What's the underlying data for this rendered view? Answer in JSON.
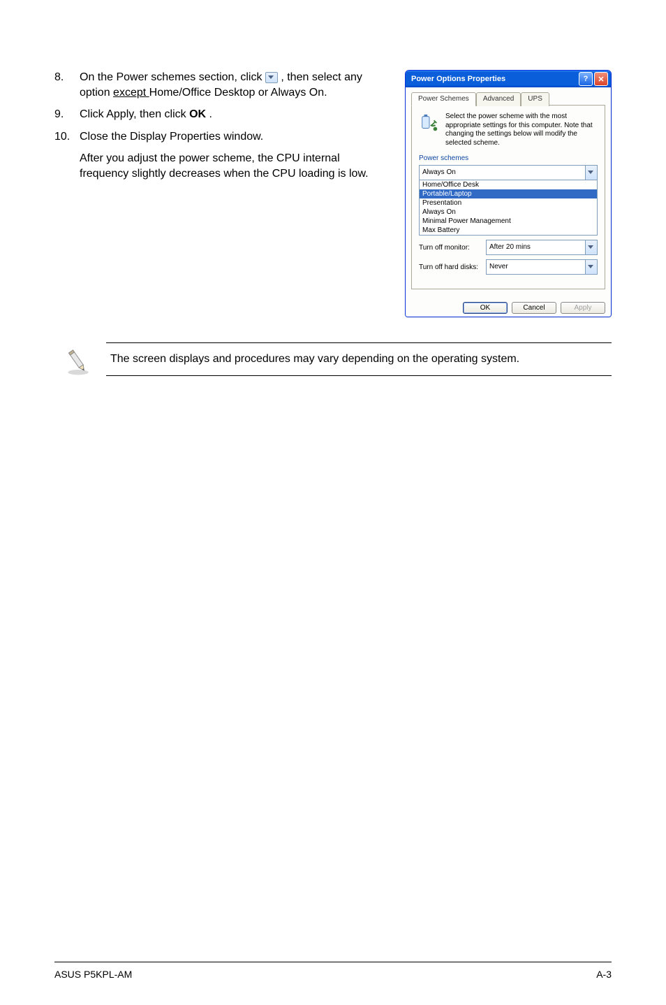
{
  "steps": [
    {
      "num": "8.",
      "pre": "On the Power schemes section, click ",
      "post": ", then select any option ",
      "underl": "except ",
      "after_underl": "Home/Office Desktop or Always On."
    },
    {
      "num": "9.",
      "text_pre": "Click Apply, then click ",
      "bold": "OK",
      "text_post": "."
    },
    {
      "num": "10.",
      "text": "Close the Display Properties window."
    }
  ],
  "after_para": "After you adjust the power scheme, the CPU internal frequency slightly decreases when the CPU loading is low.",
  "dialog": {
    "title": "Power Options Properties",
    "tabs": [
      "Power Schemes",
      "Advanced",
      "UPS"
    ],
    "active_tab": 0,
    "intro": "Select the power scheme with the most appropriate settings for this computer. Note that changing the settings below will modify the selected scheme.",
    "group_legend": "Power schemes",
    "combo_value": "Always On",
    "options": [
      "Home/Office Desk",
      "Portable/Laptop",
      "Presentation",
      "Always On",
      "Minimal Power Management",
      "Max Battery"
    ],
    "selected_option_index": 1,
    "monitor_label": "Turn off monitor:",
    "monitor_value": "After 20 mins",
    "hdd_label": "Turn off hard disks:",
    "hdd_value": "Never",
    "buttons": {
      "ok": "OK",
      "cancel": "Cancel",
      "apply": "Apply"
    }
  },
  "note": "The screen displays and procedures may vary depending on the operating system.",
  "footer": {
    "left": "ASUS P5KPL-AM",
    "right": "A-3"
  }
}
